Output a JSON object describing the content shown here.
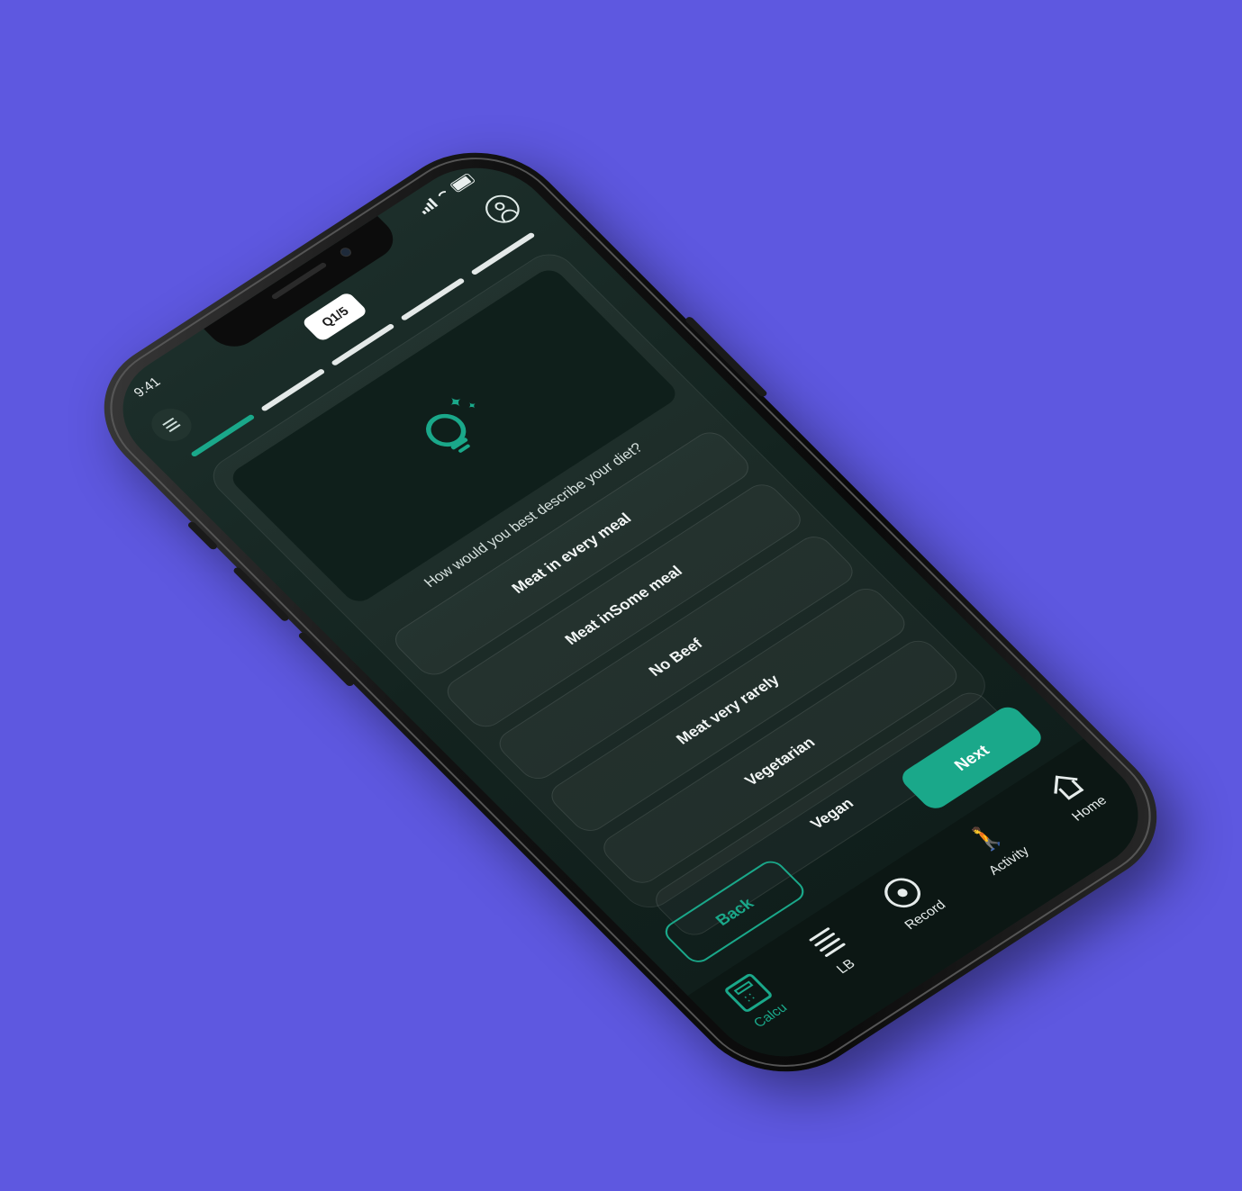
{
  "status_bar": {
    "time": "9:41"
  },
  "header": {
    "question_counter": "Q1/5"
  },
  "progress": {
    "total_steps": 5,
    "current_step": 1
  },
  "question": {
    "text": "How would you best describe your diet?"
  },
  "options": [
    {
      "label": "Meat in every meal"
    },
    {
      "label": "Meat inSome meal"
    },
    {
      "label": "No Beef"
    },
    {
      "label": "Meat very rarely"
    },
    {
      "label": "Vegetarian"
    },
    {
      "label": "Vegan"
    }
  ],
  "actions": {
    "back_label": "Back",
    "next_label": "Next"
  },
  "tabbar": {
    "items": [
      {
        "label": "Calcu",
        "icon": "calculator-icon",
        "active": true
      },
      {
        "label": "LB",
        "icon": "leaderboard-icon",
        "active": false
      },
      {
        "label": "Record",
        "icon": "record-icon",
        "active": false
      },
      {
        "label": "Activity",
        "icon": "walking-icon",
        "active": false
      },
      {
        "label": "Home",
        "icon": "home-icon",
        "active": false
      }
    ]
  },
  "colors": {
    "background": "#5e58e0",
    "accent": "#1aa88a",
    "screen": "#13231f"
  }
}
